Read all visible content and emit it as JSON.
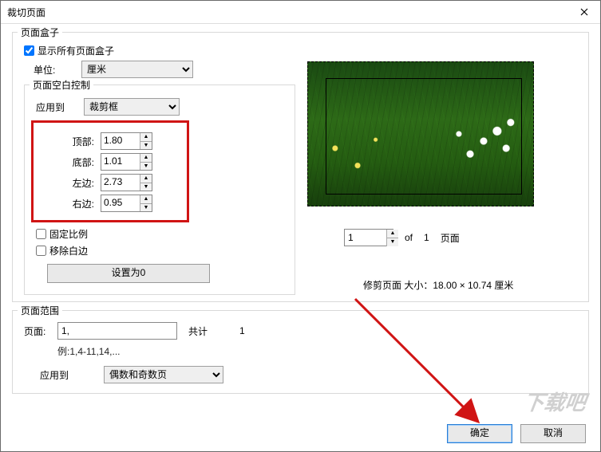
{
  "window": {
    "title": "裁切页面"
  },
  "page_box": {
    "legend": "页面盒子",
    "show_all_label": "显示所有页面盒子",
    "show_all_checked": true,
    "unit_label": "单位:",
    "unit_value": "厘米"
  },
  "margins": {
    "legend": "页面空白控制",
    "apply_to_label": "应用到",
    "apply_to_value": "裁剪框",
    "top_label": "顶部:",
    "top_value": "1.80",
    "bottom_label": "底部:",
    "bottom_value": "1.01",
    "left_label": "左边:",
    "left_value": "2.73",
    "right_label": "右边:",
    "right_value": "0.95",
    "lock_ratio_label": "固定比例",
    "remove_white_label": "移除白边",
    "reset_label": "设置为0"
  },
  "pager": {
    "page_value": "1",
    "of_label": "of",
    "total": "1",
    "unit_label": "页面"
  },
  "range": {
    "legend": "页面范围",
    "page_label": "页面:",
    "page_value": "1,",
    "total_label": "共计",
    "total_value": "1",
    "example_label": "例:1,4-11,14,...",
    "apply_to_label": "应用到",
    "apply_to_value": "偶数和奇数页"
  },
  "crop_size_label": "修剪页面 大小：18.00 × 10.74  厘米",
  "buttons": {
    "ok": "确定",
    "cancel": "取消"
  },
  "watermark": "下载吧"
}
